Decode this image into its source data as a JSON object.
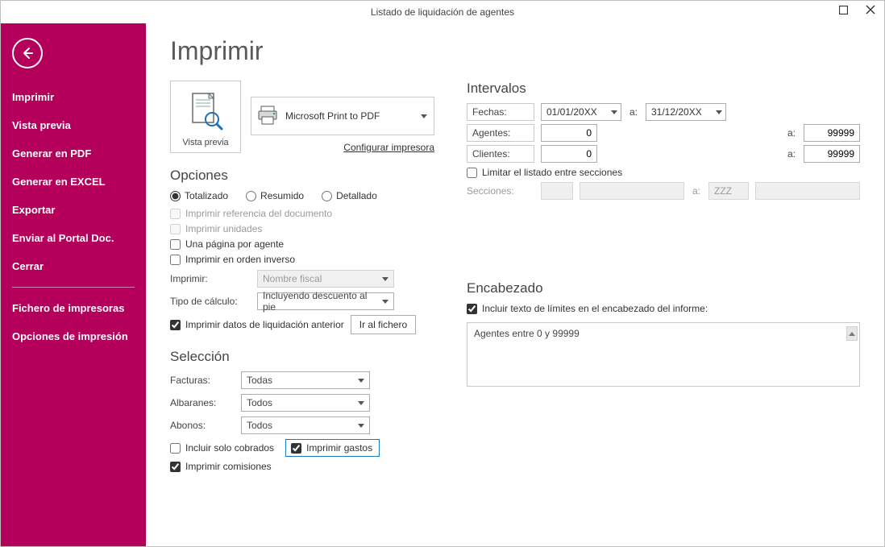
{
  "window": {
    "title": "Listado de liquidación de agentes"
  },
  "page": {
    "title": "Imprimir"
  },
  "sidebar": {
    "items": [
      {
        "label": "Imprimir"
      },
      {
        "label": "Vista previa"
      },
      {
        "label": "Generar en PDF"
      },
      {
        "label": "Generar en EXCEL"
      },
      {
        "label": "Exportar"
      },
      {
        "label": "Enviar al Portal Doc."
      },
      {
        "label": "Cerrar"
      }
    ],
    "footer": [
      {
        "label": "Fichero de impresoras"
      },
      {
        "label": "Opciones de impresión"
      }
    ]
  },
  "preview_tile": {
    "caption": "Vista previa"
  },
  "printer": {
    "name": "Microsoft Print to PDF",
    "config_link": "Configurar impresora"
  },
  "sections": {
    "opciones": "Opciones",
    "seleccion": "Selección",
    "intervalos": "Intervalos",
    "encabezado": "Encabezado"
  },
  "opciones": {
    "radios": {
      "totalizado": "Totalizado",
      "resumido": "Resumido",
      "detallado": "Detallado",
      "selected": "totalizado"
    },
    "ref_doc": "Imprimir referencia del documento",
    "unidades": "Imprimir unidades",
    "una_pagina": "Una página por agente",
    "orden_inverso": "Imprimir en orden inverso",
    "imprimir_label": "Imprimir:",
    "imprimir_value": "Nombre fiscal",
    "tipo_label": "Tipo de cálculo:",
    "tipo_value": "Incluyendo descuento al pie",
    "datos_anterior": "Imprimir datos de liquidación anterior",
    "ir_fichero": "Ir al fichero"
  },
  "seleccion": {
    "facturas_label": "Facturas:",
    "facturas_value": "Todas",
    "albaranes_label": "Albaranes:",
    "albaranes_value": "Todos",
    "abonos_label": "Abonos:",
    "abonos_value": "Todos",
    "solo_cobrados": "Incluir solo cobrados",
    "imprimir_gastos": "Imprimir gastos",
    "imprimir_comisiones": "Imprimir comisiones"
  },
  "intervalos": {
    "fechas_label": "Fechas:",
    "fecha_desde": "01/01/20XX",
    "a": "a:",
    "fecha_hasta": "31/12/20XX",
    "agentes_label": "Agentes:",
    "agentes_desde": "0",
    "agentes_hasta": "99999",
    "clientes_label": "Clientes:",
    "clientes_desde": "0",
    "clientes_hasta": "99999",
    "limitar": "Limitar el listado entre secciones",
    "secciones_label": "Secciones:",
    "secciones_hasta": "ZZZ"
  },
  "encabezado": {
    "incluir": "Incluir texto de límites en el encabezado del informe:",
    "texto": "Agentes entre 0 y 99999"
  }
}
